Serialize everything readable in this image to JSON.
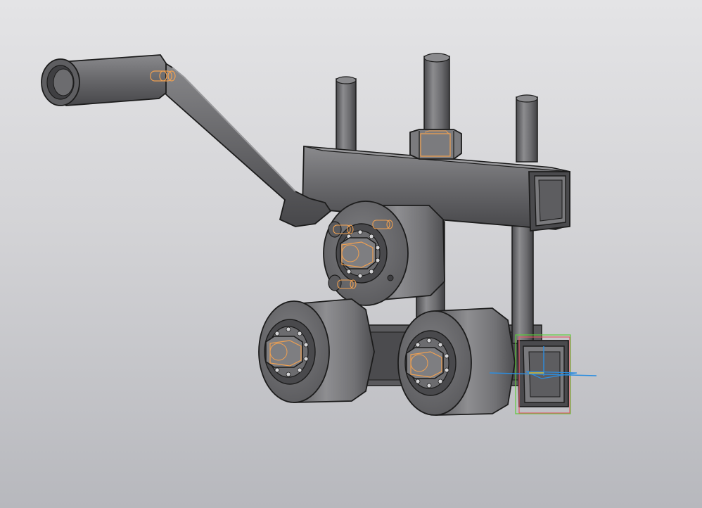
{
  "viewport": {
    "background_top": "#e4e4e6",
    "background_bottom": "#b7b8bd"
  },
  "model": {
    "type": "3D CAD assembly",
    "render_style": "shaded with edges",
    "body_color": "#6e6e70",
    "edge_color": "#1c1c1c",
    "highlight_color": "#f0a050",
    "parts": [
      "handle-grip",
      "crank-arm",
      "upper-roller",
      "lower-roller-left",
      "lower-roller-right",
      "top-square-tube",
      "bottom-square-tube",
      "threaded-rods",
      "adjusting-nut",
      "bolt-heads"
    ]
  },
  "triad": {
    "x_color": "#2b8de0",
    "y_color": "#5ecb3a",
    "z_color": "#e05a6a"
  }
}
